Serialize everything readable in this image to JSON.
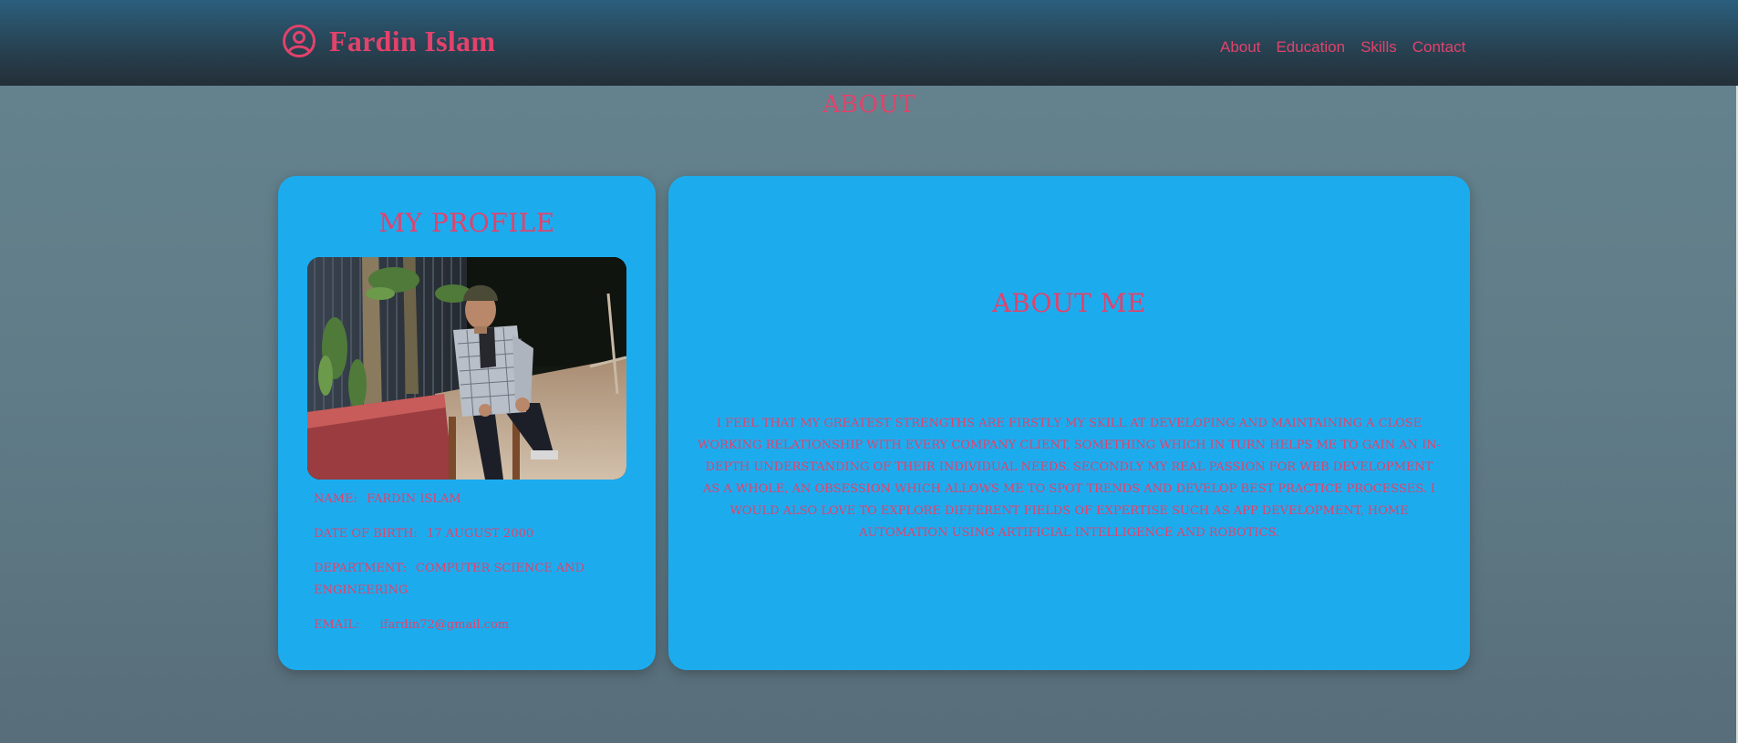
{
  "navbar": {
    "brand_icon": "user-circle-icon",
    "brand_name": "Fardin Islam",
    "links": [
      "About",
      "Education",
      "Skills",
      "Contact"
    ]
  },
  "page": {
    "title": "ABOUT"
  },
  "profile": {
    "heading": "MY PROFILE",
    "photo": "profile-photo",
    "name_label": "NAME:",
    "name_value": "FARDIN ISLAM",
    "dob_label": "DATE OF BIRTH:",
    "dob_value": "17 AUGUST 2000",
    "dept_label": "DEPARTMENT:",
    "dept_value": "COMPUTER SCIENCE AND ENGINEERING",
    "email_label": "EMAIL:",
    "email_value": "ifardin72@gmail.com"
  },
  "about": {
    "heading": "ABOUT ME",
    "text": "I FEEL THAT MY GREATEST STRENGTHS ARE FIRSTLY MY SKILL AT DEVELOPING AND MAINTAINING A CLOSE WORKING RELATIONSHIP WITH EVERY COMPANY CLIENT, SOMETHING WHICH IN TURN HELPS ME TO GAIN AN IN-DEPTH UNDERSTANDING OF THEIR INDIVIDUAL NEEDS. SECONDLY MY REAL PASSION FOR WEB DEVELOPMENT AS A WHOLE, AN OBSESSION WHICH ALLOWS ME TO SPOT TRENDS AND DEVELOP BEST PRACTICE PROCESSES. I WOULD ALSO LOVE TO EXPLORE DIFFERENT FIELDS OF EXPERTISE SUCH AS APP DEVELOPMENT, HOME AUTOMATION USING ARTIFICIAL INTELLIGENCE AND ROBOTICS."
  },
  "colors": {
    "accent": "#e2426b",
    "card": "#1cacee",
    "navbar_top": "#2b5f7d",
    "navbar_bottom": "#242f38",
    "background": "#5f7b87"
  }
}
